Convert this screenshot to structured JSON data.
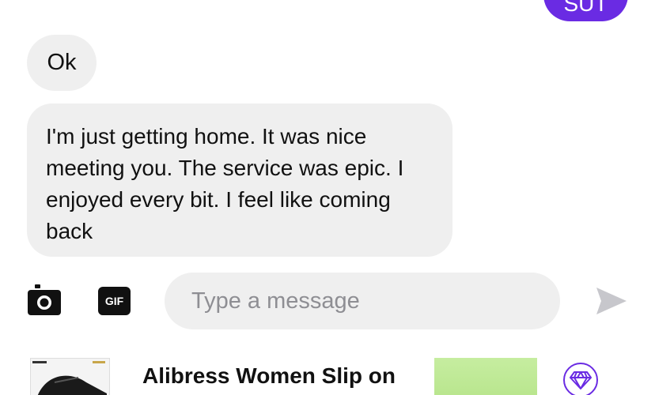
{
  "conversation": {
    "sent_partial_label": "SUT",
    "messages": [
      {
        "text": "Ok"
      },
      {
        "text": "I'm just getting home. It was nice meeting you. The service was epic. I enjoyed every bit. I feel like coming back"
      }
    ]
  },
  "composer": {
    "gif_label": "GIF",
    "placeholder": "Type a message",
    "camera_icon": "camera-icon",
    "send_icon": "send-icon"
  },
  "ad": {
    "title": "Alibress Women Slip on",
    "premium_icon": "diamond-icon"
  },
  "colors": {
    "accent": "#6a2be3",
    "bubble_received": "#efefef",
    "send_icon": "#c7c7cc"
  }
}
